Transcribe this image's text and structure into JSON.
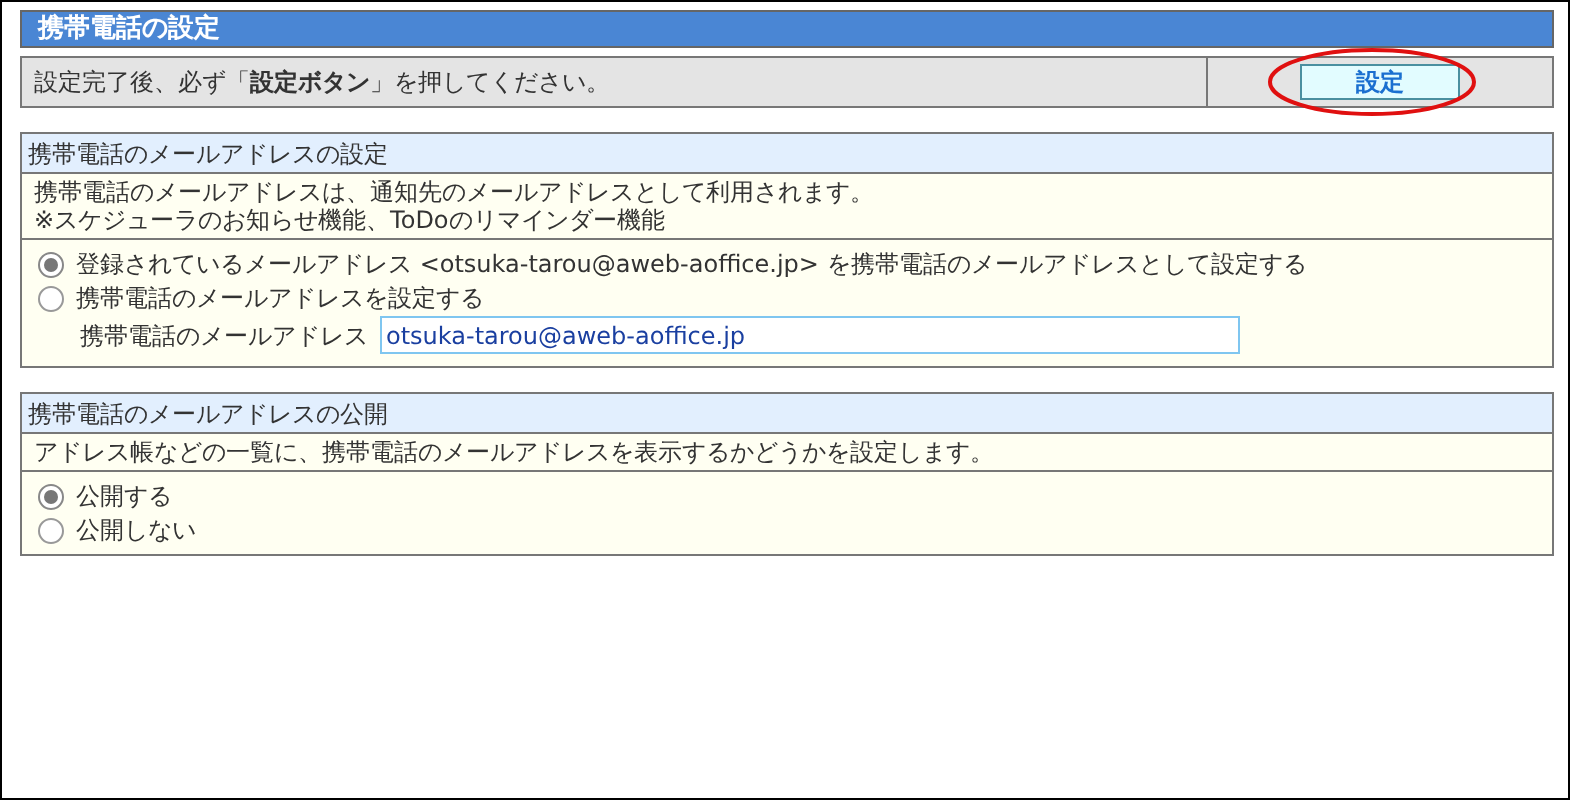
{
  "title": "携帯電話の設定",
  "notice": {
    "message": "設定完了後、必ず「**設定ボタン**」を押してください。",
    "button": "設定",
    "highlighted": true
  },
  "sections": [
    {
      "heading": "携帯電話のメールアドレスの設定",
      "description_lines": [
        "携帯電話のメールアドレスは、通知先のメールアドレスとして利用されます。",
        "※スケジューラのお知らせ機能、ToDoのリマインダー機能"
      ],
      "options": [
        {
          "label": "登録されているメールアドレス <otsuka-tarou@aweb-aoffice.jp> を携帯電話のメールアドレスとして設定する",
          "selected": true
        },
        {
          "label": "携帯電話のメールアドレスを設定する",
          "selected": false
        }
      ],
      "field": {
        "label": "携帯電話のメールアドレス",
        "value": "otsuka-tarou@aweb-aoffice.jp"
      }
    },
    {
      "heading": "携帯電話のメールアドレスの公開",
      "description_lines": [
        "アドレス帳などの一覧に、携帯電話のメールアドレスを表示するかどうかを設定します。"
      ],
      "options": [
        {
          "label": "公開する",
          "selected": true
        },
        {
          "label": "公開しない",
          "selected": false
        }
      ]
    }
  ]
}
